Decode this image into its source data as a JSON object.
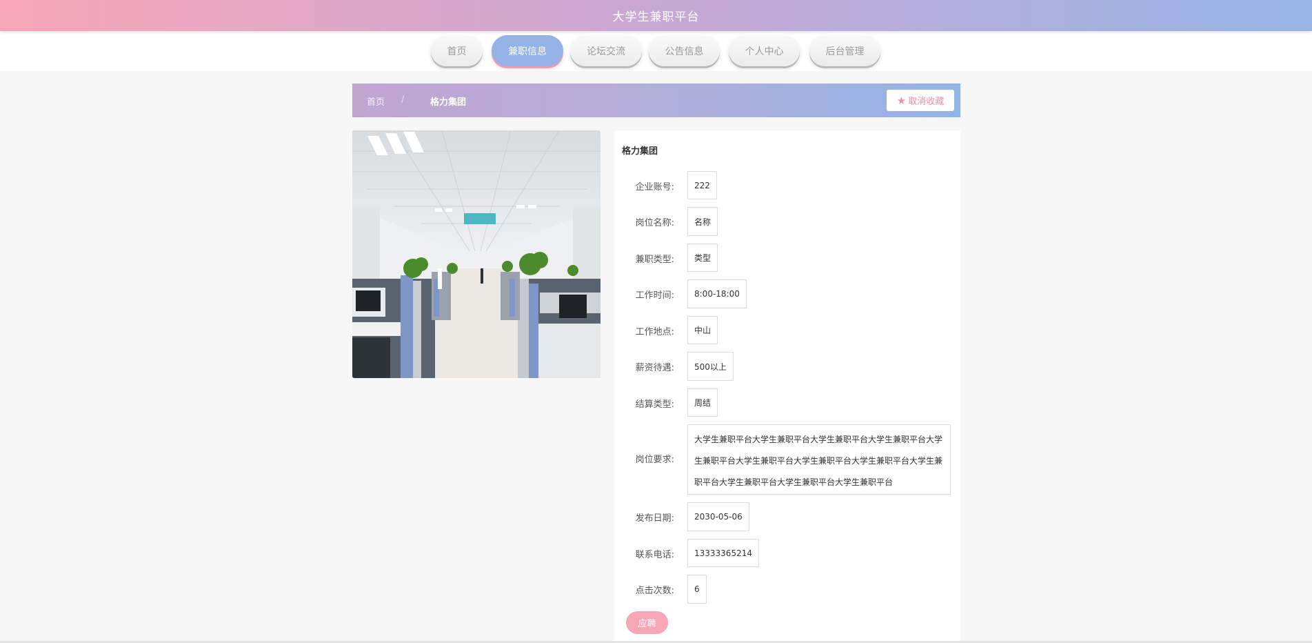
{
  "header": {
    "title": "大学生兼职平台"
  },
  "nav": {
    "items": [
      {
        "label": "首页",
        "active": false
      },
      {
        "label": "兼职信息",
        "active": true
      },
      {
        "label": "论坛交流",
        "active": false
      },
      {
        "label": "公告信息",
        "active": false
      },
      {
        "label": "个人中心",
        "active": false
      },
      {
        "label": "后台管理",
        "active": false
      }
    ]
  },
  "breadcrumb": {
    "home": "首页",
    "separator": "/",
    "current": "格力集团"
  },
  "favorite": {
    "icon": "star-icon",
    "label": "取消收藏"
  },
  "detail": {
    "company": "格力集团",
    "fields": [
      {
        "label": "企业账号:",
        "value": "222"
      },
      {
        "label": "岗位名称:",
        "value": "名称"
      },
      {
        "label": "兼职类型:",
        "value": "类型"
      },
      {
        "label": "工作时间:",
        "value": "8:00-18:00"
      },
      {
        "label": "工作地点:",
        "value": "中山"
      },
      {
        "label": "薪资待遇:",
        "value": "500以上"
      },
      {
        "label": "结算类型:",
        "value": "周结"
      },
      {
        "label": "岗位要求:",
        "value": "大学生兼职平台大学生兼职平台大学生兼职平台大学生兼职平台大学生兼职平台大学生兼职平台大学生兼职平台大学生兼职平台大学生兼职平台大学生兼职平台大学生兼职平台大学生兼职平台"
      },
      {
        "label": "发布日期:",
        "value": "2030-05-06"
      },
      {
        "label": "联系电话:",
        "value": "13333365214"
      },
      {
        "label": "点击次数:",
        "value": "6"
      }
    ],
    "apply_label": "应聘"
  },
  "colors": {
    "accent_pink": "#f7a6b6",
    "accent_blue": "#95b3e6",
    "accent_purple": "#c1a5d1"
  }
}
